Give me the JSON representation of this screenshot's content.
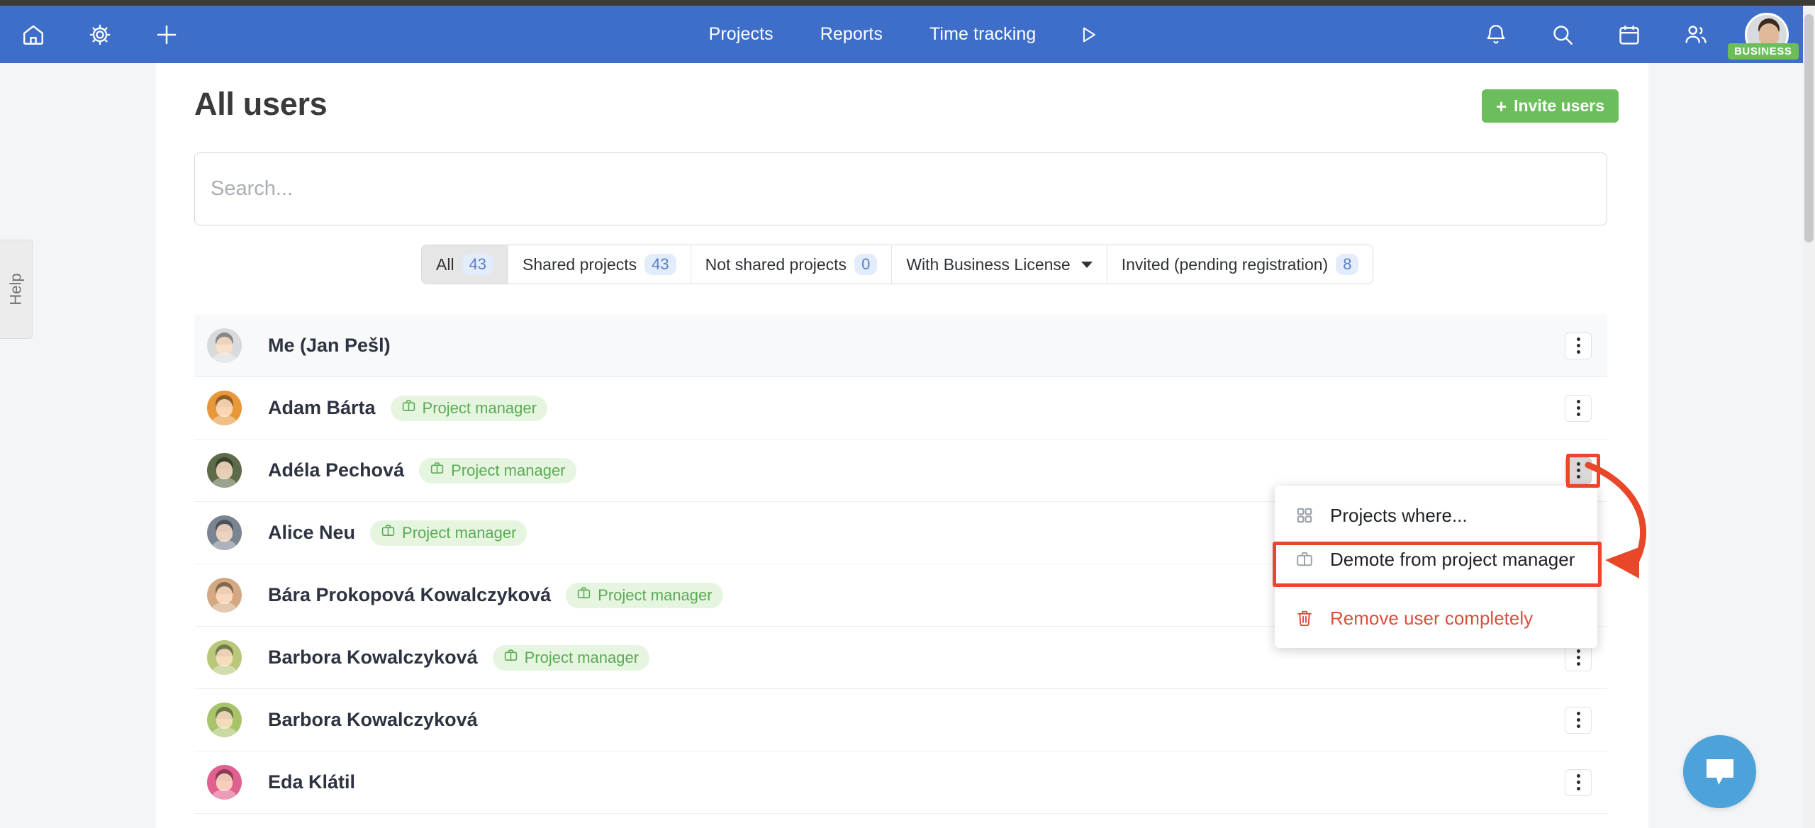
{
  "topnav": {
    "left_icons": [
      {
        "name": "home-icon",
        "label": "Home"
      },
      {
        "name": "gear-icon",
        "label": "Settings"
      },
      {
        "name": "plus-icon",
        "label": "Add"
      }
    ],
    "links": [
      {
        "label": "Projects"
      },
      {
        "label": "Reports"
      },
      {
        "label": "Time tracking"
      }
    ],
    "play_icon": "play-triangle-icon",
    "right_icons": [
      {
        "name": "bell-icon",
        "label": "Notifications"
      },
      {
        "name": "search-icon",
        "label": "Search"
      },
      {
        "name": "calendar-icon",
        "label": "Calendar"
      },
      {
        "name": "people-icon",
        "label": "Users"
      }
    ],
    "avatar_badge": "BUSINESS",
    "bg_color": "#3f6ec9"
  },
  "help_tab": {
    "label": "Help"
  },
  "header": {
    "title": "All users",
    "invite_button": "Invite users",
    "invite_plus": "+",
    "invite_color": "#6cbe5c"
  },
  "search": {
    "value": "",
    "placeholder": "Search..."
  },
  "filters": {
    "items": [
      {
        "label": "All",
        "count": "43",
        "active": true,
        "caret": false
      },
      {
        "label": "Shared projects",
        "count": "43",
        "active": false,
        "caret": false
      },
      {
        "label": "Not shared projects",
        "count": "0",
        "active": false,
        "caret": false
      },
      {
        "label": "With Business License",
        "count": "",
        "active": false,
        "caret": true
      },
      {
        "label": "Invited (pending registration)",
        "count": "8",
        "active": false,
        "caret": false
      }
    ]
  },
  "users": [
    {
      "name": "Me (Jan Pešl)",
      "badge": "",
      "highlight": true,
      "kebab_pressed": false,
      "avatar": "#d8dade"
    },
    {
      "name": "Adam Bárta",
      "badge": "Project manager",
      "highlight": false,
      "kebab_pressed": false,
      "avatar": "#e8983a"
    },
    {
      "name": "Adéla Pechová",
      "badge": "Project manager",
      "highlight": false,
      "kebab_pressed": true,
      "avatar": "#5d6b4a"
    },
    {
      "name": "Alice Neu",
      "badge": "Project manager",
      "highlight": false,
      "kebab_pressed": false,
      "avatar": "#7b8592"
    },
    {
      "name": "Bára Prokopová Kowalczyková",
      "badge": "Project manager",
      "highlight": false,
      "kebab_pressed": false,
      "avatar": "#d4a882"
    },
    {
      "name": "Barbora Kowalczyková",
      "badge": "Project manager",
      "highlight": false,
      "kebab_pressed": false,
      "avatar": "#b8c77a"
    },
    {
      "name": "Barbora Kowalczyková",
      "badge": "",
      "highlight": false,
      "kebab_pressed": false,
      "avatar": "#a8c46a"
    },
    {
      "name": "Eda Klátil",
      "badge": "",
      "highlight": false,
      "kebab_pressed": false,
      "avatar": "#e0608f"
    }
  ],
  "badge_label": "Project manager",
  "dropdown": {
    "items": [
      {
        "label": "Projects where...",
        "icon": "grid-icon",
        "danger": false
      },
      {
        "label": "Demote from project manager",
        "icon": "briefcase-icon",
        "danger": false
      },
      {
        "label": "Remove user completely",
        "icon": "trash-icon",
        "danger": true
      }
    ]
  },
  "annotation": {
    "color": "#e8472a",
    "target": "Demote from project manager"
  },
  "chat": {
    "icon": "chat-bubble-icon",
    "color": "#4da2d9"
  }
}
